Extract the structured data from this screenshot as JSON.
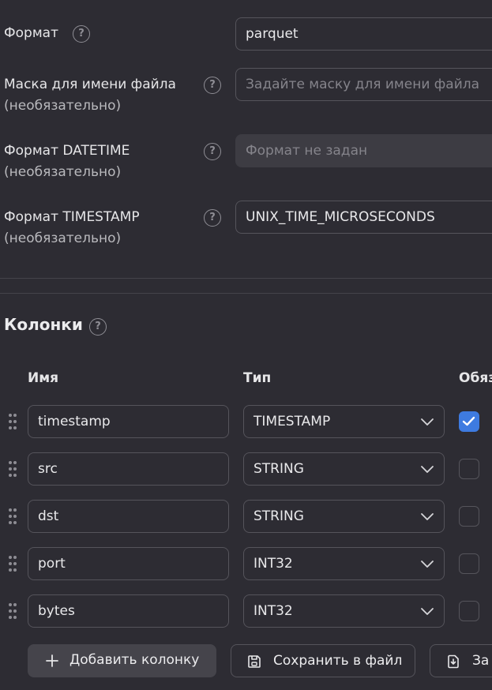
{
  "settings": {
    "format": {
      "label": "Формат",
      "value": "parquet"
    },
    "file_mask": {
      "label": "Маска для имени файла",
      "sublabel": "(необязательно)",
      "placeholder": "Задайте маску для имени файла"
    },
    "datetime_format": {
      "label": "Формат DATETIME",
      "sublabel": "(необязательно)",
      "placeholder": "Формат не задан"
    },
    "timestamp_format": {
      "label": "Формат TIMESTAMP",
      "sublabel": "(необязательно)",
      "value": "UNIX_TIME_MICROSECONDS"
    }
  },
  "columns": {
    "title": "Колонки",
    "headers": {
      "name": "Имя",
      "type": "Тип",
      "required": "Обяз"
    },
    "rows": [
      {
        "name": "timestamp",
        "type": "TIMESTAMP",
        "required": true
      },
      {
        "name": "src",
        "type": "STRING",
        "required": false
      },
      {
        "name": "dst",
        "type": "STRING",
        "required": false
      },
      {
        "name": "port",
        "type": "INT32",
        "required": false
      },
      {
        "name": "bytes",
        "type": "INT32",
        "required": false
      }
    ]
  },
  "actions": {
    "add_column": "Добавить колонку",
    "save_to_file": "Сохранить в файл",
    "load_from_file": "За"
  },
  "colors": {
    "accent": "#3e7be0",
    "background": "#2d2c33"
  }
}
